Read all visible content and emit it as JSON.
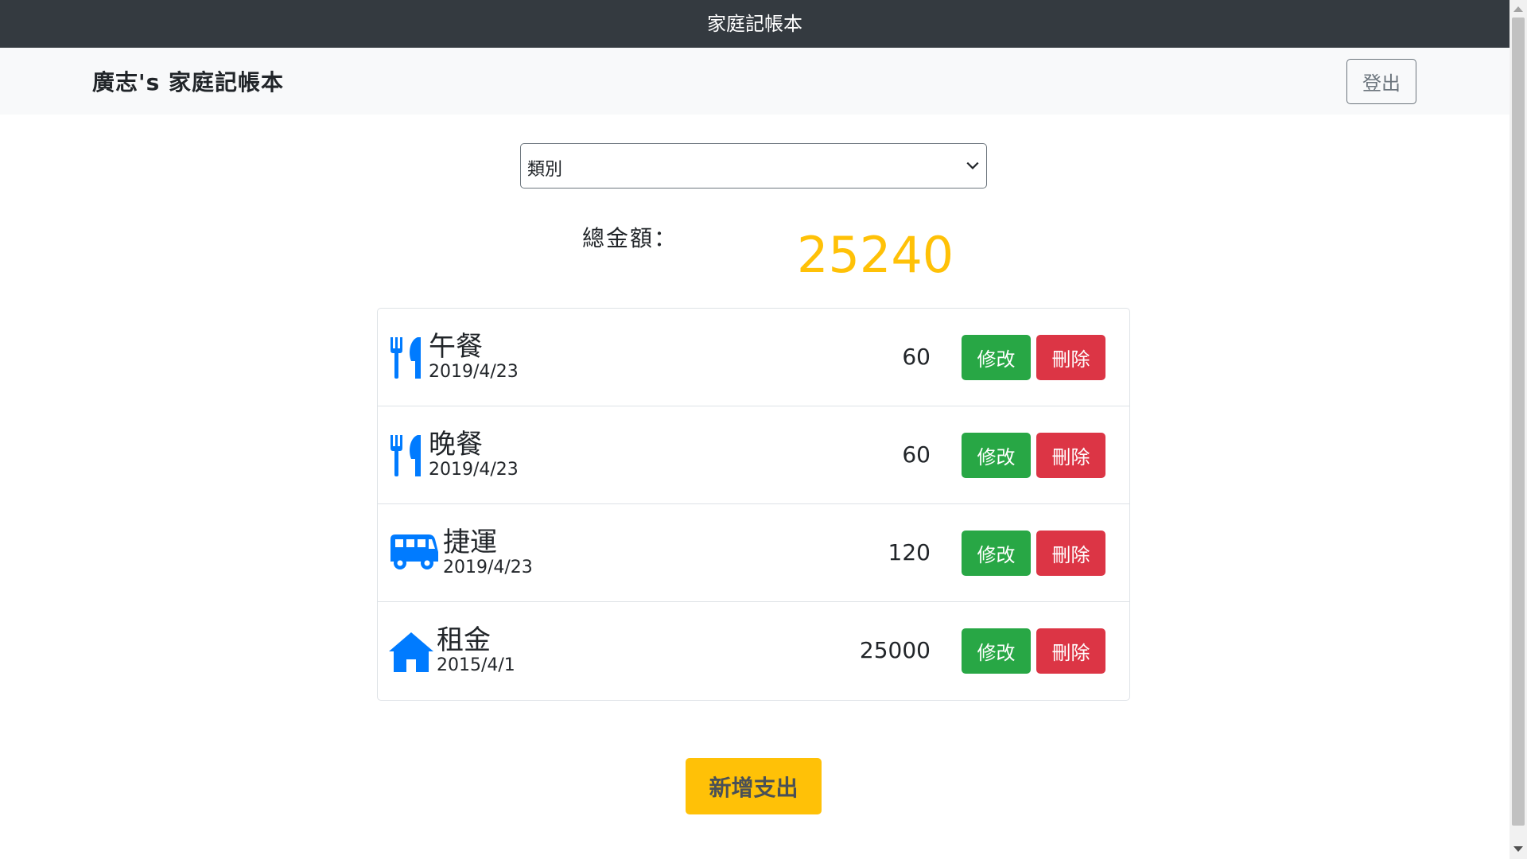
{
  "titlebar": {
    "title": "家庭記帳本"
  },
  "navbar": {
    "brand": "廣志's 家庭記帳本",
    "logout_label": "登出"
  },
  "filter": {
    "selected": "類別"
  },
  "total": {
    "label": "總金額：",
    "value": "25240"
  },
  "items": [
    {
      "icon": "utensils-icon",
      "name": "午餐",
      "date": "2019/4/23",
      "amount": "60",
      "edit_label": "修改",
      "delete_label": "刪除"
    },
    {
      "icon": "utensils-icon",
      "name": "晚餐",
      "date": "2019/4/23",
      "amount": "60",
      "edit_label": "修改",
      "delete_label": "刪除"
    },
    {
      "icon": "bus-icon",
      "name": "捷運",
      "date": "2019/4/23",
      "amount": "120",
      "edit_label": "修改",
      "delete_label": "刪除"
    },
    {
      "icon": "home-icon",
      "name": "租金",
      "date": "2015/4/1",
      "amount": "25000",
      "edit_label": "修改",
      "delete_label": "刪除"
    }
  ],
  "add_button": {
    "label": "新增支出"
  },
  "colors": {
    "header": "#343a40",
    "icon": "#007bff",
    "edit": "#28a745",
    "delete": "#dc3545",
    "accent": "#ffc107"
  }
}
